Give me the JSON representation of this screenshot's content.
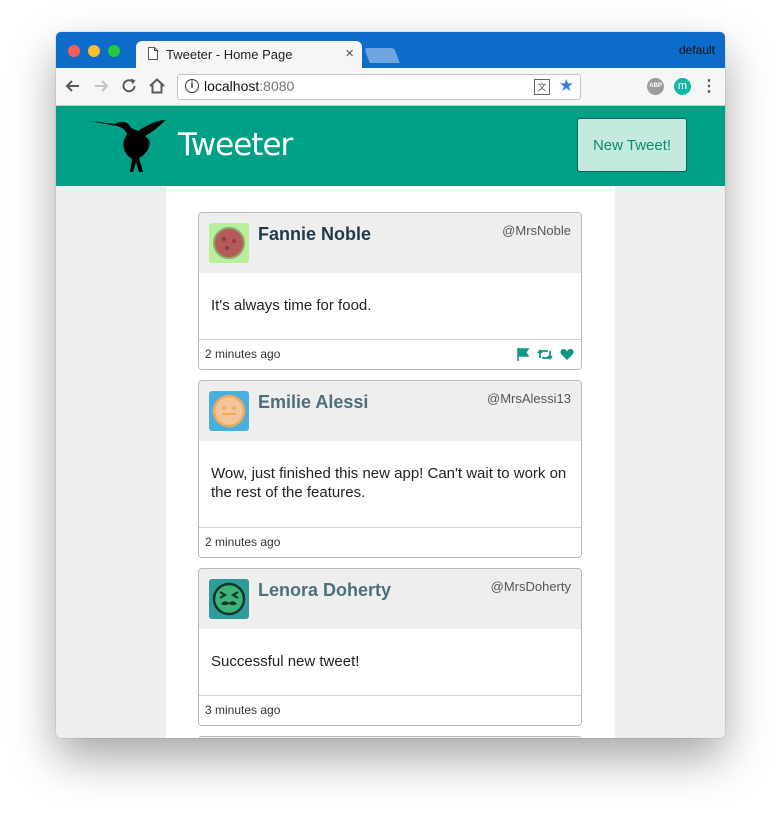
{
  "browser": {
    "tab_title": "Tweeter - Home Page",
    "tab_close": "×",
    "profile_name": "default",
    "url_host": "localhost",
    "url_port": ":8080",
    "icons": [
      "back-icon",
      "forward-icon",
      "reload-icon",
      "home-icon",
      "info-icon",
      "translate-icon",
      "star-icon",
      "adblock-icon",
      "extension-m-icon",
      "menu-icon"
    ]
  },
  "app": {
    "brand": "Tweeter",
    "new_tweet_label": "New Tweet!",
    "colors": {
      "header": "#00a087",
      "accent": "#0b8a72",
      "button_bg": "#c4eadf"
    }
  },
  "tweets": [
    {
      "name": "Fannie Noble",
      "handle": "@MrsNoble",
      "text": "It's always time for food.",
      "time": "2 minutes ago",
      "name_color": "#1f3a48",
      "avatar": "pizza-avatar",
      "actions": [
        "flag-icon",
        "retweet-icon",
        "heart-icon"
      ]
    },
    {
      "name": "Emilie Alessi",
      "handle": "@MrsAlessi13",
      "text": "Wow, just finished this new app! Can't wait to work on the rest of the features.",
      "time": "2 minutes ago",
      "name_color": "#4d6f7c",
      "avatar": "smiley-avatar"
    },
    {
      "name": "Lenora Doherty",
      "handle": "@MrsDoherty",
      "text": "Successful new tweet!",
      "time": "3 minutes ago",
      "name_color": "#4d6f7c",
      "avatar": "mustache-avatar"
    }
  ]
}
